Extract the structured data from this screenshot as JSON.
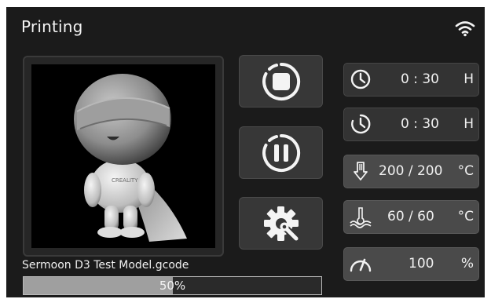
{
  "header": {
    "title": "Printing",
    "wifi_icon": "wifi-icon"
  },
  "job": {
    "filename": "Sermoon D3 Test Model.gcode",
    "progress_label": "50%",
    "progress_fraction": 0.5
  },
  "controls": [
    {
      "name": "stop-button",
      "icon": "stop-icon"
    },
    {
      "name": "pause-button",
      "icon": "pause-icon"
    },
    {
      "name": "settings-button",
      "icon": "settings-wrench-icon"
    }
  ],
  "stats": {
    "elapsed": {
      "value": "0 : 30",
      "unit": "H",
      "icon": "clock-icon"
    },
    "remaining": {
      "value": "0 : 30",
      "unit": "H",
      "icon": "clock-remaining-icon"
    },
    "nozzle_temp": {
      "value": "200 / 200",
      "unit": "°C",
      "icon": "nozzle-temperature-icon"
    },
    "bed_temp": {
      "value": "60 / 60",
      "unit": "°C",
      "icon": "bed-temperature-icon"
    },
    "speed": {
      "value": "100",
      "unit": "%",
      "icon": "speed-gauge-icon"
    }
  },
  "model_preview": {
    "badge_text": "CREALITY"
  }
}
